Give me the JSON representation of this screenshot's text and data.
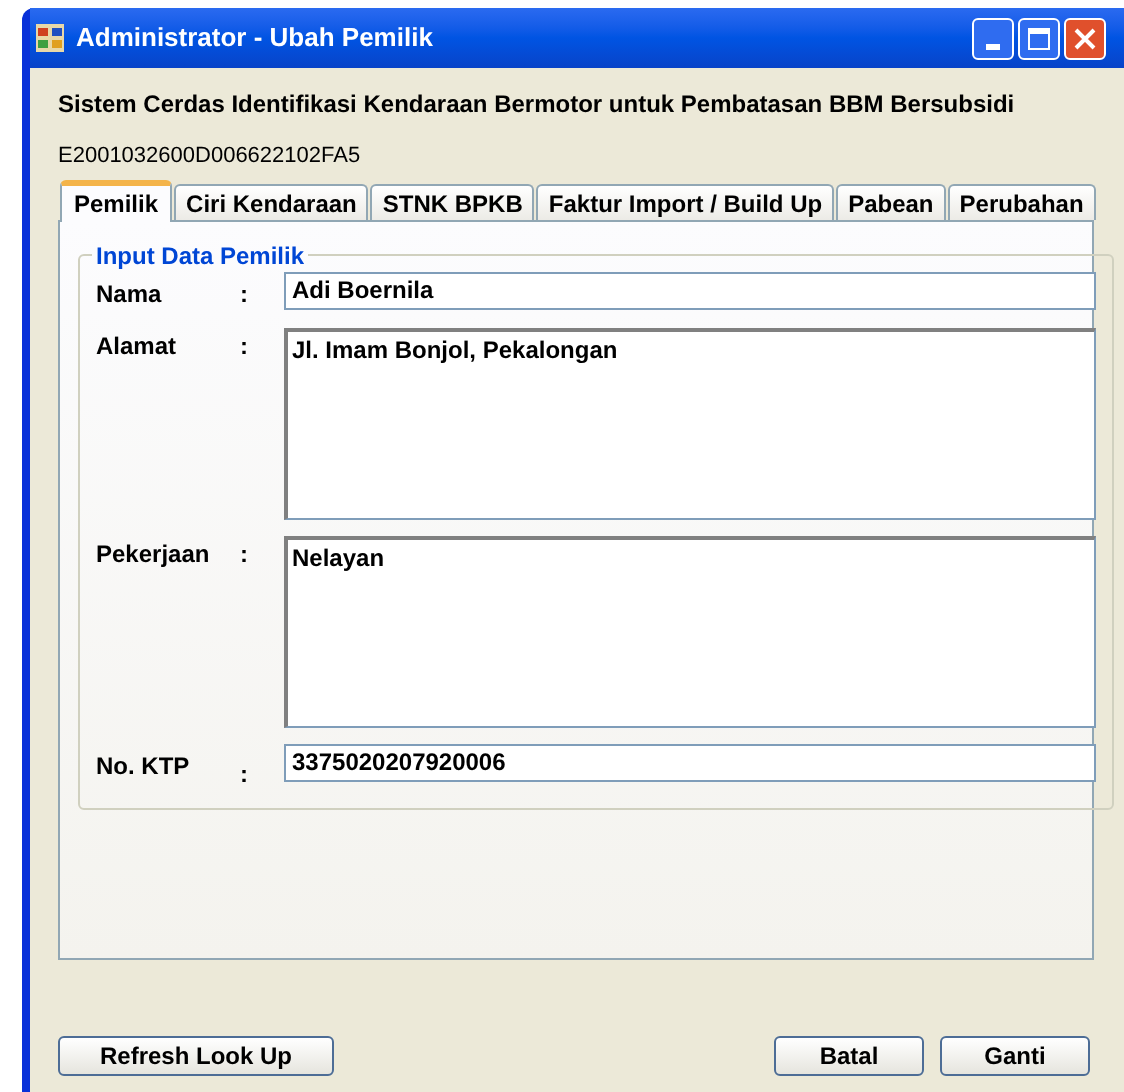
{
  "window": {
    "title": "Administrator - Ubah Pemilik"
  },
  "heading": "Sistem Cerdas Identifikasi Kendaraan Bermotor untuk Pembatasan BBM Bersubsidi",
  "tag_id": "E2001032600D006622102FA5",
  "tabs": [
    {
      "label": "Pemilik",
      "selected": true
    },
    {
      "label": "Ciri Kendaraan",
      "selected": false
    },
    {
      "label": "STNK BPKB",
      "selected": false
    },
    {
      "label": "Faktur Import / Build Up",
      "selected": false
    },
    {
      "label": "Pabean",
      "selected": false
    },
    {
      "label": "Perubahan",
      "selected": false
    }
  ],
  "group": {
    "title": "Input Data Pemilik",
    "fields": [
      {
        "kind": "line",
        "label": "Nama",
        "colon": ":",
        "value": "Adi Boernila"
      },
      {
        "kind": "area",
        "label": "Alamat",
        "colon": ":",
        "value": "Jl. Imam Bonjol, Pekalongan"
      },
      {
        "kind": "area",
        "label": "Pekerjaan",
        "colon": ":",
        "value": "Nelayan"
      },
      {
        "kind": "line",
        "label": "No. KTP",
        "colon": ":",
        "value": "3375020207920006"
      }
    ]
  },
  "buttons": {
    "left": [
      "Refresh Look Up"
    ],
    "right": [
      "Batal",
      "Ganti"
    ]
  }
}
